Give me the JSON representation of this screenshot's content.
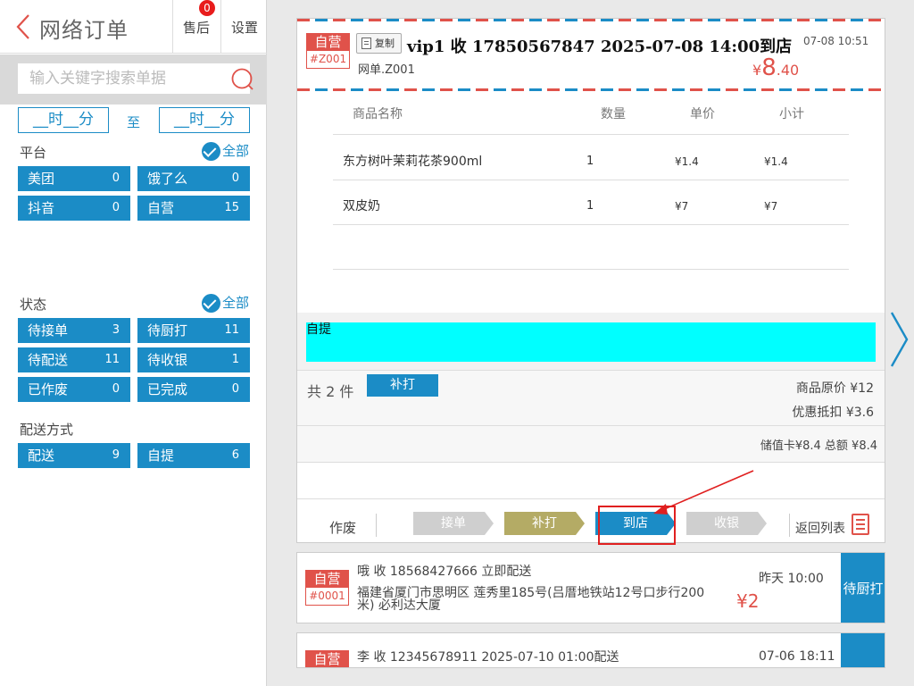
{
  "sidebar": {
    "title": "网络订单",
    "after_sale_label": "售后",
    "after_sale_count": "0",
    "settings_label": "设置",
    "search_placeholder": "输入关键字搜索单据",
    "time_from": "__时__分",
    "time_sep": "至",
    "time_to": "__时__分",
    "platform": {
      "label": "平台",
      "all_label": "全部",
      "items": [
        {
          "label": "美团",
          "count": "0"
        },
        {
          "label": "饿了么",
          "count": "0"
        },
        {
          "label": "抖音",
          "count": "0"
        },
        {
          "label": "自营",
          "count": "15"
        }
      ]
    },
    "status": {
      "label": "状态",
      "all_label": "全部",
      "items": [
        {
          "label": "待接单",
          "count": "3"
        },
        {
          "label": "待厨打",
          "count": "11"
        },
        {
          "label": "待配送",
          "count": "11"
        },
        {
          "label": "待收银",
          "count": "1"
        },
        {
          "label": "已作废",
          "count": "0"
        },
        {
          "label": "已完成",
          "count": "0"
        }
      ]
    },
    "delivery": {
      "label": "配送方式",
      "items": [
        {
          "label": "配送",
          "count": "9"
        },
        {
          "label": "自提",
          "count": "6"
        }
      ]
    }
  },
  "order": {
    "tag_top": "自营",
    "tag_bottom": "#Z001",
    "copy_label": "复制",
    "title": "vip1 收 17850567847 2025-07-08 14:00到店",
    "time": "07-08 10:51",
    "subtitle": "网单.Z001",
    "price_symbol": "¥",
    "price_int": "8",
    "price_dec": ".40",
    "columns": {
      "name": "商品名称",
      "qty": "数量",
      "price": "单价",
      "subtotal": "小计"
    },
    "items": [
      {
        "name": "东方树叶茉莉花茶900ml",
        "qty": "1",
        "price": "¥1.4",
        "subtotal": "¥1.4"
      },
      {
        "name": "双皮奶",
        "qty": "1",
        "price": "¥7",
        "subtotal": "¥7"
      }
    ],
    "note": "自提",
    "total_count": "共 2 件",
    "reprint_label": "补打",
    "original_price": "商品原价 ¥12",
    "discount": "优惠抵扣 ¥3.6",
    "payment": "储值卡¥8.4   总额 ¥8.4",
    "actions": {
      "void": "作废",
      "accept": "接单",
      "reprint": "补打",
      "arrive": "到店",
      "cashier": "收银",
      "back_list": "返回列表"
    }
  },
  "order_list": [
    {
      "tag_top": "自营",
      "tag_bottom": "#0001",
      "title": "哦 收 18568427666 立即配送",
      "time": "昨天 10:00",
      "address": "福建省厦门市思明区 莲秀里185号(吕厝地铁站12号口步行200米) 必利达大厦",
      "price": "¥2",
      "status": "待厨打"
    },
    {
      "tag_top": "自营",
      "tag_bottom": "",
      "title": "李 收 12345678911 2025-07-10 01:00配送",
      "time": "07-06 18:11",
      "status": ""
    }
  ],
  "colors": {
    "accent": "#1b8cc6",
    "brand_red": "#e0524a",
    "note_bg": "#00ffff",
    "reprint_step": "#b4ab65"
  }
}
